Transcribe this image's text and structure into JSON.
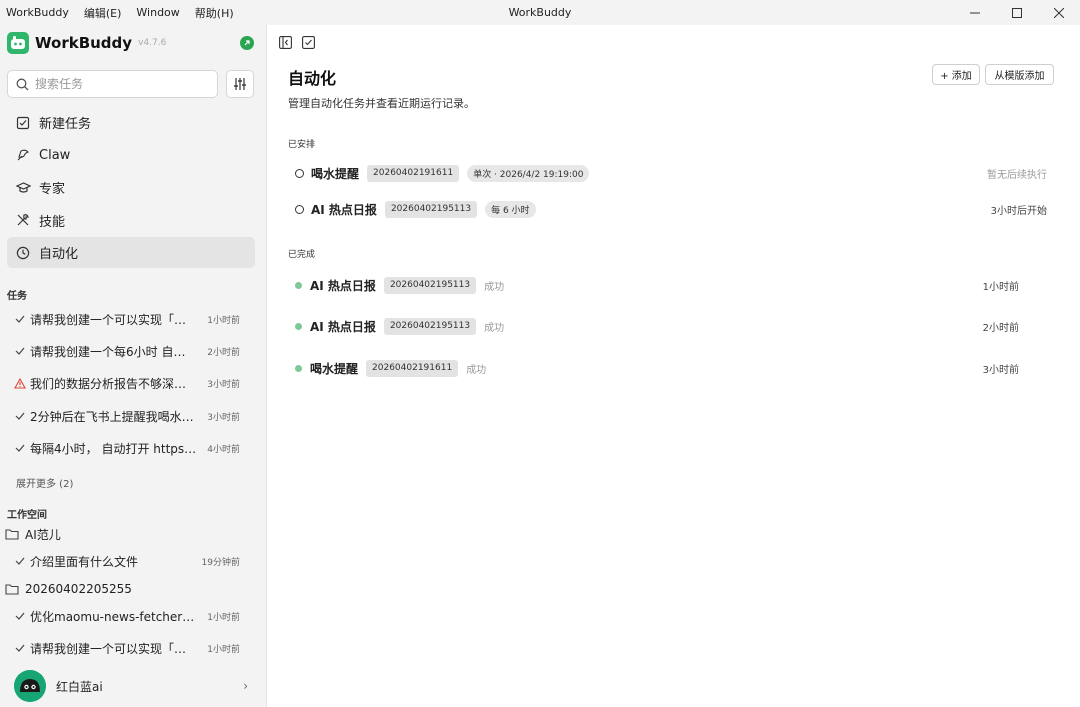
{
  "window": {
    "menu": [
      "WorkBuddy",
      "编辑(E)",
      "Window",
      "帮助(H)"
    ],
    "title": "WorkBuddy"
  },
  "sidebar": {
    "brand": "WorkBuddy",
    "version": "v4.7.6",
    "search_placeholder": "搜索任务",
    "nav": [
      {
        "label": "新建任务",
        "icon": "edit-icon"
      },
      {
        "label": "Claw",
        "icon": "claw-icon"
      },
      {
        "label": "专家",
        "icon": "graduation-cap-icon"
      },
      {
        "label": "技能",
        "icon": "tools-icon"
      },
      {
        "label": "自动化",
        "icon": "clock-icon"
      }
    ],
    "tasks_label": "任务",
    "tasks": [
      {
        "text": "请帮我创建一个可以实现「…",
        "time": "1小时前",
        "status": "done"
      },
      {
        "text": "请帮我创建一个每6小时 自…",
        "time": "2小时前",
        "status": "done"
      },
      {
        "text": "我们的数据分析报告不够深…",
        "time": "3小时前",
        "status": "warning"
      },
      {
        "text": "2分钟后在飞书上提醒我喝水…",
        "time": "3小时前",
        "status": "done"
      },
      {
        "text": "每隔4小时， 自动打开 https:…",
        "time": "4小时前",
        "status": "done"
      }
    ],
    "more": "展开更多 (2)",
    "workspace_label": "工作空间",
    "workspaces": [
      {
        "folder": "AI范儿",
        "items": [
          {
            "text": "介绍里面有什么文件",
            "time": "19分钟前"
          }
        ]
      },
      {
        "folder": "20260402205255",
        "items": [
          {
            "text": "优化maomu-news-fetcher这…",
            "time": "1小时前"
          },
          {
            "text": "请帮我创建一个可以实现「…",
            "time": "1小时前"
          }
        ]
      }
    ],
    "user": "红白蓝ai"
  },
  "main": {
    "title": "自动化",
    "description": "管理自动化任务并查看近期运行记录。",
    "add_button": "+ 添加",
    "template_button": "从模版添加",
    "scheduled_label": "已安排",
    "scheduled": [
      {
        "name": "喝水提醒",
        "id": "20260402191611",
        "schedule": "单次 · 2026/4/2 19:19:00",
        "right": "暂无后续执行"
      },
      {
        "name": "AI 热点日报",
        "id": "20260402195113",
        "schedule": "每 6 小时",
        "right": "3小时后开始"
      }
    ],
    "completed_label": "已完成",
    "completed": [
      {
        "name": "AI 热点日报",
        "id": "20260402195113",
        "result": "成功",
        "time": "1小时前"
      },
      {
        "name": "AI 热点日报",
        "id": "20260402195113",
        "result": "成功",
        "time": "2小时前"
      },
      {
        "name": "喝水提醒",
        "id": "20260402191611",
        "result": "成功",
        "time": "3小时前"
      }
    ]
  },
  "colors": {
    "brand": "#2fb66a",
    "success_dot": "#7fc89a",
    "warning": "#e0443a"
  }
}
